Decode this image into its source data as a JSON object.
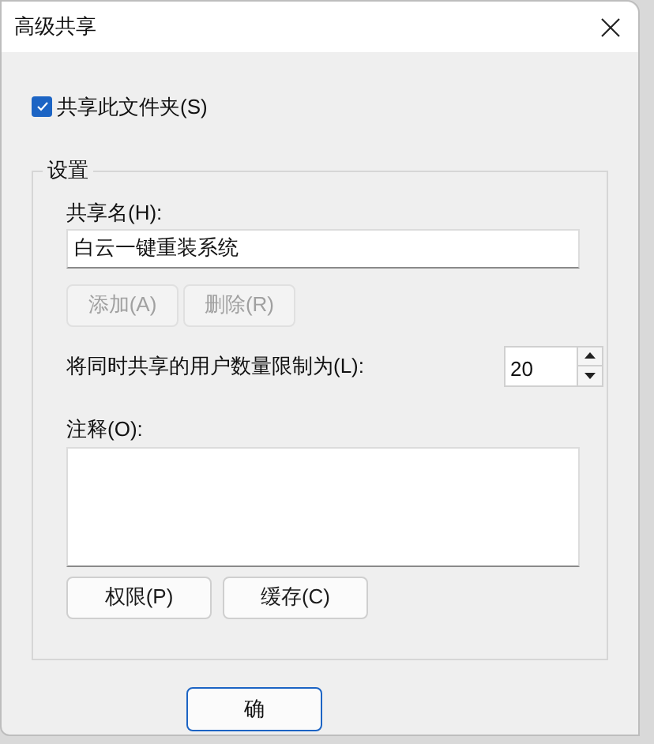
{
  "window": {
    "title": "高级共享"
  },
  "share_checkbox": {
    "label": "共享此文件夹(S)",
    "checked": true
  },
  "settings": {
    "legend": "设置",
    "share_name_label": "共享名(H):",
    "share_name_value": "白云一键重装系统",
    "name_buttons": [
      {
        "label": "添加(A)",
        "disabled": true
      },
      {
        "label": "删除(R)",
        "disabled": true
      }
    ],
    "limit_label": "将同时共享的用户数量限制为(L):",
    "limit_value": "20",
    "comment_label": "注释(O):",
    "buttons": [
      {
        "label": "权限(P)",
        "disabled": false
      },
      {
        "label": "缓存(C)",
        "disabled": false
      }
    ]
  },
  "footer_buttons": [
    {
      "label": "确"
    }
  ]
}
